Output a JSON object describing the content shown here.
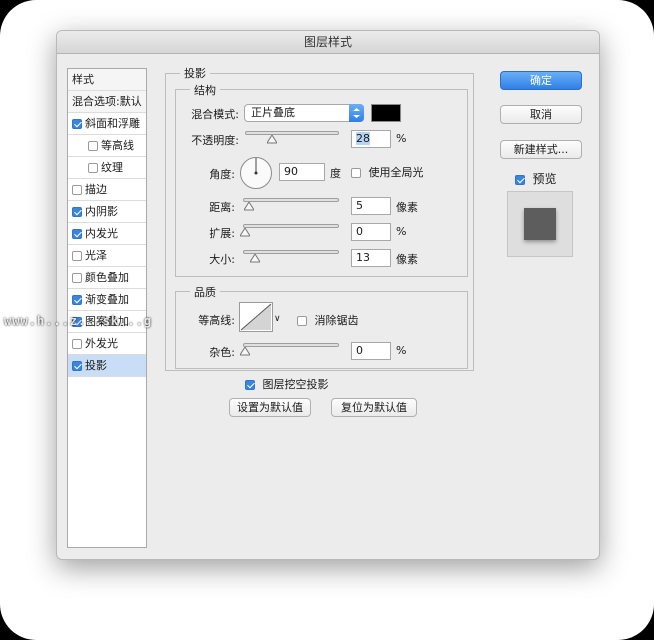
{
  "window": {
    "title": "图层样式"
  },
  "left_panel": {
    "styles_header": "样式",
    "blend_options": "混合选项:默认",
    "items": [
      {
        "label": "斜面和浮雕",
        "checked": true,
        "sub": false
      },
      {
        "label": "等高线",
        "checked": false,
        "sub": true
      },
      {
        "label": "纹理",
        "checked": false,
        "sub": true
      },
      {
        "label": "描边",
        "checked": false,
        "sub": false
      },
      {
        "label": "内阴影",
        "checked": true,
        "sub": false
      },
      {
        "label": "内发光",
        "checked": true,
        "sub": false
      },
      {
        "label": "光泽",
        "checked": false,
        "sub": false
      },
      {
        "label": "颜色叠加",
        "checked": false,
        "sub": false
      },
      {
        "label": "渐变叠加",
        "checked": true,
        "sub": false
      },
      {
        "label": "图案叠加",
        "checked": true,
        "sub": false
      },
      {
        "label": "外发光",
        "checked": false,
        "sub": false
      },
      {
        "label": "投影",
        "checked": true,
        "sub": false,
        "selected": true
      }
    ]
  },
  "drop_shadow": {
    "title": "投影",
    "structure": {
      "title": "结构",
      "blend_mode_label": "混合模式:",
      "blend_mode_value": "正片叠底",
      "shadow_color": "#000000",
      "opacity_label": "不透明度:",
      "opacity_value": "28",
      "opacity_unit": "%",
      "angle_label": "角度:",
      "angle_value": "90",
      "angle_unit": "度",
      "global_light_label": "使用全局光",
      "global_light_checked": false,
      "distance_label": "距离:",
      "distance_value": "5",
      "distance_unit": "像素",
      "spread_label": "扩展:",
      "spread_value": "0",
      "spread_unit": "%",
      "size_label": "大小:",
      "size_value": "13",
      "size_unit": "像素"
    },
    "quality": {
      "title": "品质",
      "contour_label": "等高线:",
      "anti_alias_label": "消除锯齿",
      "anti_alias_checked": false,
      "noise_label": "杂色:",
      "noise_value": "0",
      "noise_unit": "%"
    },
    "knockout_label": "图层挖空投影",
    "knockout_checked": true,
    "make_default_label": "设置为默认值",
    "reset_default_label": "复位为默认值"
  },
  "right_panel": {
    "ok_label": "确定",
    "cancel_label": "取消",
    "new_style_label": "新建样式...",
    "preview_label": "预览",
    "preview_checked": true
  },
  "watermark": "www.h...z...sk...g"
}
